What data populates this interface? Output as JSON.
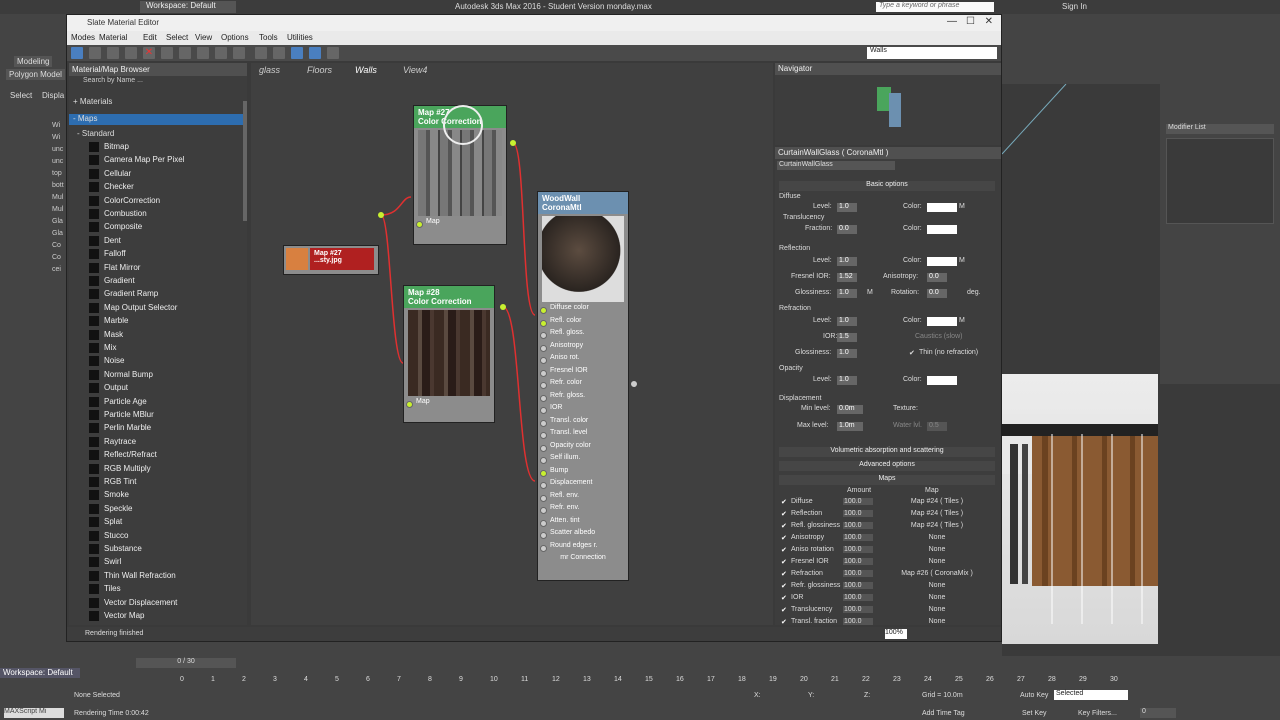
{
  "app": {
    "title": "Autodesk 3ds Max 2016 - Student Version   monday.max",
    "search_placeholder": "Type a keyword or phrase",
    "sign_in": "Sign In",
    "workspace_top": "Workspace: Default",
    "ribbon_tabs": [
      "Modeling",
      "Polygon Model"
    ],
    "left_labels": [
      "Select",
      "Displa"
    ],
    "scene_items": [
      "Wi",
      "Wi",
      "unc",
      "unc",
      "top",
      "bott",
      "Mul",
      "Mul",
      "Gla",
      "Gla",
      "Co",
      "Co",
      "cei"
    ],
    "modifier_list": "Modifier List"
  },
  "slate": {
    "title": "Slate Material Editor",
    "menu": [
      "Modes",
      "Material",
      "Edit",
      "Select",
      "View",
      "Options",
      "Tools",
      "Utilities"
    ],
    "view_dropdown": "Walls",
    "browser": {
      "title": "Material/Map Browser",
      "search": "Search by Name ...",
      "groups": [
        "+ Materials",
        "- Maps",
        "- Standard"
      ],
      "items": [
        "Bitmap",
        "Camera Map Per Pixel",
        "Cellular",
        "Checker",
        "ColorCorrection",
        "Combustion",
        "Composite",
        "Dent",
        "Falloff",
        "Flat Mirror",
        "Gradient",
        "Gradient Ramp",
        "Map Output Selector",
        "Marble",
        "Mask",
        "Mix",
        "Noise",
        "Normal Bump",
        "Output",
        "Particle Age",
        "Particle MBlur",
        "Perlin Marble",
        "Raytrace",
        "Reflect/Refract",
        "RGB Multiply",
        "RGB Tint",
        "Smoke",
        "Speckle",
        "Splat",
        "Stucco",
        "Substance",
        "Swirl",
        "Thin Wall Refraction",
        "Tiles",
        "Vector Displacement",
        "Vector Map"
      ]
    },
    "view_tabs": [
      "glass",
      "Floors",
      "Walls",
      "View4"
    ],
    "nodes": {
      "cc1": {
        "line1": "Map #27",
        "line2": "Color Correction",
        "slot": "Map"
      },
      "bitmap": {
        "line1": "Map #27",
        "line2": "...sty.jpg"
      },
      "cc2": {
        "line1": "Map #28",
        "line2": "Color Correction",
        "slot": "Map"
      },
      "mtl": {
        "line1": "WoodWall",
        "line2": "CoronaMtl",
        "footer": "mr Connection",
        "slots": [
          "Diffuse color",
          "Refl. color",
          "Refl. gloss.",
          "Anisotropy",
          "Aniso rot.",
          "Fresnel IOR",
          "Refr. color",
          "Refr. gloss.",
          "IOR",
          "Transl. color",
          "Transl. level",
          "Opacity color",
          "Self illum.",
          "Bump",
          "Displacement",
          "Refl. env.",
          "Refr. env.",
          "Atten. tint",
          "Scatter albedo",
          "Round edges r."
        ]
      }
    },
    "navigator": {
      "title": "Navigator"
    },
    "params": {
      "title": "CurtainWallGlass ( CoronaMtl )",
      "name": "CurtainWallGlass",
      "basic": "Basic options",
      "diffuse": "Diffuse",
      "level": "Level:",
      "color": "Color:",
      "translucency": "Translucency",
      "fraction": "Fraction:",
      "reflection": "Reflection",
      "fresnel": "Fresnel IOR:",
      "anisotropy": "Anisotropy:",
      "glossiness": "Glossiness:",
      "rotation": "Rotation:",
      "deg": "deg.",
      "refraction": "Refraction",
      "ior": "IOR:",
      "caustics": "Caustics (slow)",
      "thin": "Thin (no refraction)",
      "opacity": "Opacity",
      "displacement": "Displacement",
      "min_level": "Min level:",
      "max_level": "Max level:",
      "texture": "Texture:",
      "water": "Water lvl.",
      "v_1": "1.0",
      "v_0": "0.0",
      "v_152": "1.52",
      "v_15": "1.5",
      "v_0m": "0.0m",
      "v_1m": "1.0m",
      "v_05": "0.5",
      "m": "M",
      "volumetric": "Volumetric absorption and scattering",
      "advanced": "Advanced options",
      "maps_title": "Maps",
      "amount": "Amount",
      "map": "Map",
      "maps": [
        {
          "name": "Diffuse",
          "amount": "100.0",
          "map": "Map #24 ( Tiles )"
        },
        {
          "name": "Reflection",
          "amount": "100.0",
          "map": "Map #24 ( Tiles )"
        },
        {
          "name": "Refl. glossiness",
          "amount": "100.0",
          "map": "Map #24 ( Tiles )"
        },
        {
          "name": "Anisotropy",
          "amount": "100.0",
          "map": "None"
        },
        {
          "name": "Aniso rotation",
          "amount": "100.0",
          "map": "None"
        },
        {
          "name": "Fresnel IOR",
          "amount": "100.0",
          "map": "None"
        },
        {
          "name": "Refraction",
          "amount": "100.0",
          "map": "Map #26 ( CoronaMix )"
        },
        {
          "name": "Refr. glossiness",
          "amount": "100.0",
          "map": "None"
        },
        {
          "name": "IOR",
          "amount": "100.0",
          "map": "None"
        },
        {
          "name": "Translucency",
          "amount": "100.0",
          "map": "None"
        },
        {
          "name": "Transl. fraction",
          "amount": "100.0",
          "map": "None"
        }
      ]
    },
    "status": "Rendering finished",
    "zoom": "100%"
  },
  "bottom": {
    "frame": "0 / 30",
    "ticks": [
      "0",
      "1",
      "2",
      "3",
      "4",
      "5",
      "6",
      "7",
      "8",
      "9",
      "10",
      "11",
      "12",
      "13",
      "14",
      "15",
      "16",
      "17",
      "18",
      "19",
      "20",
      "21",
      "22",
      "23",
      "24",
      "25",
      "26",
      "27",
      "28",
      "29",
      "30"
    ],
    "workspace": "Workspace: Default",
    "none_selected": "None Selected",
    "render_time": "Rendering Time  0:00:42",
    "maxscript": "MAXScript Mi",
    "grid": "Grid = 10.0m",
    "add_time_tag": "Add Time Tag",
    "auto_key": "Auto Key",
    "set_key": "Set Key",
    "selected": "Selected",
    "key_filters": "Key Filters...",
    "x": "X:",
    "y": "Y:",
    "z": "Z:",
    "frame_num": "0"
  }
}
